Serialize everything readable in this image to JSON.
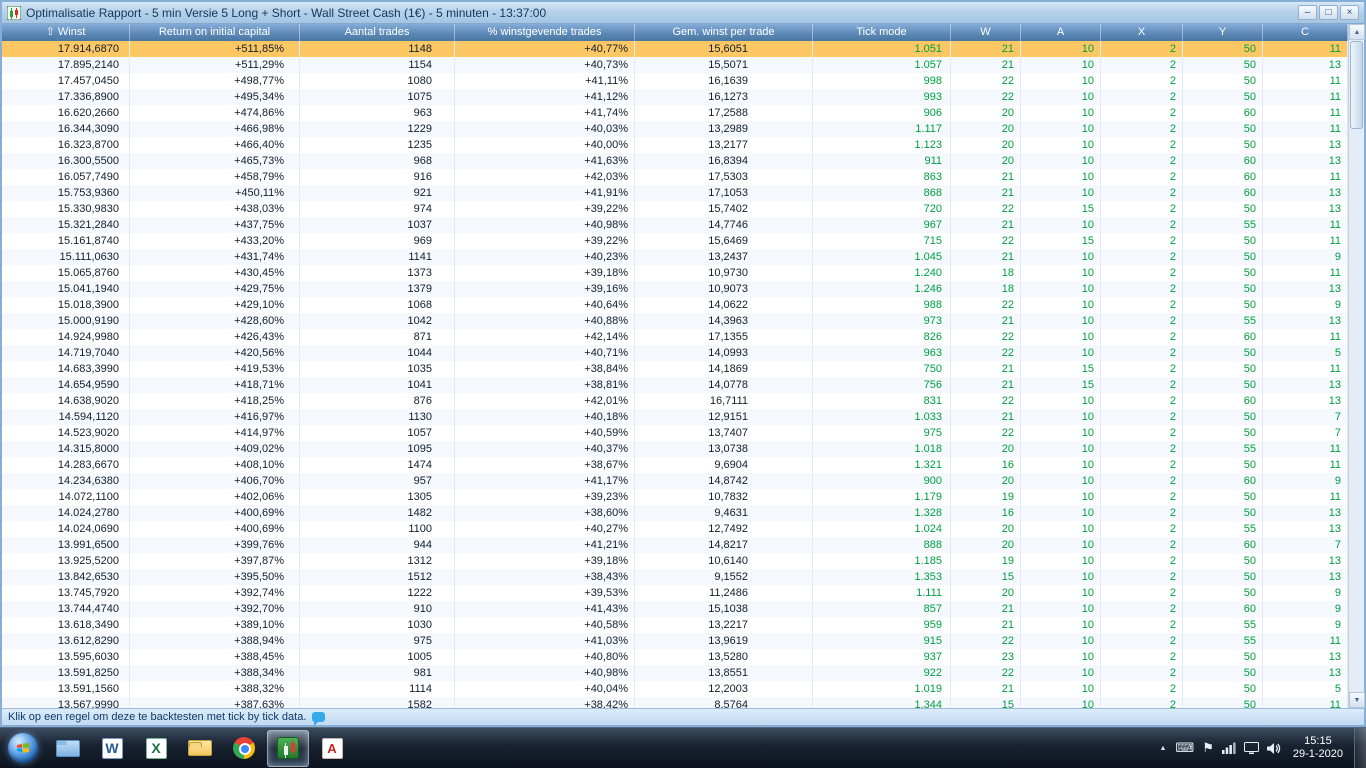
{
  "window": {
    "title": "Optimalisatie Rapport - 5 min Versie 5 Long + Short - Wall Street Cash (1€) - 5 minuten - 13:37:00",
    "buttons": {
      "minimize": "–",
      "maximize": "□",
      "close": "×"
    }
  },
  "table": {
    "sort_arrow": "⇧",
    "sort_column": "Winst",
    "selected_row_index": 0,
    "columns": [
      "Winst",
      "Return on initial capital",
      "Aantal trades",
      "% winstgevende trades",
      "Gem. winst per trade",
      "Tick mode",
      "W",
      "A",
      "X",
      "Y",
      "C"
    ],
    "rows": [
      [
        "17.914,6870",
        "+511,85%",
        "1148",
        "+40,77%",
        "15,6051",
        "1.051",
        "21",
        "10",
        "2",
        "50",
        "11"
      ],
      [
        "17.895,2140",
        "+511,29%",
        "1154",
        "+40,73%",
        "15,5071",
        "1.057",
        "21",
        "10",
        "2",
        "50",
        "13"
      ],
      [
        "17.457,0450",
        "+498,77%",
        "1080",
        "+41,11%",
        "16,1639",
        "998",
        "22",
        "10",
        "2",
        "50",
        "11"
      ],
      [
        "17.336,8900",
        "+495,34%",
        "1075",
        "+41,12%",
        "16,1273",
        "993",
        "22",
        "10",
        "2",
        "50",
        "11"
      ],
      [
        "16.620,2660",
        "+474,86%",
        "963",
        "+41,74%",
        "17,2588",
        "906",
        "20",
        "10",
        "2",
        "60",
        "11"
      ],
      [
        "16.344,3090",
        "+466,98%",
        "1229",
        "+40,03%",
        "13,2989",
        "1.117",
        "20",
        "10",
        "2",
        "50",
        "11"
      ],
      [
        "16.323,8700",
        "+466,40%",
        "1235",
        "+40,00%",
        "13,2177",
        "1.123",
        "20",
        "10",
        "2",
        "50",
        "13"
      ],
      [
        "16.300,5500",
        "+465,73%",
        "968",
        "+41,63%",
        "16,8394",
        "911",
        "20",
        "10",
        "2",
        "60",
        "13"
      ],
      [
        "16.057,7490",
        "+458,79%",
        "916",
        "+42,03%",
        "17,5303",
        "863",
        "21",
        "10",
        "2",
        "60",
        "11"
      ],
      [
        "15.753,9360",
        "+450,11%",
        "921",
        "+41,91%",
        "17,1053",
        "868",
        "21",
        "10",
        "2",
        "60",
        "13"
      ],
      [
        "15.330,9830",
        "+438,03%",
        "974",
        "+39,22%",
        "15,7402",
        "720",
        "22",
        "15",
        "2",
        "50",
        "13"
      ],
      [
        "15.321,2840",
        "+437,75%",
        "1037",
        "+40,98%",
        "14,7746",
        "967",
        "21",
        "10",
        "2",
        "55",
        "11"
      ],
      [
        "15.161,8740",
        "+433,20%",
        "969",
        "+39,22%",
        "15,6469",
        "715",
        "22",
        "15",
        "2",
        "50",
        "11"
      ],
      [
        "15.111,0630",
        "+431,74%",
        "1141",
        "+40,23%",
        "13,2437",
        "1.045",
        "21",
        "10",
        "2",
        "50",
        "9"
      ],
      [
        "15.065,8760",
        "+430,45%",
        "1373",
        "+39,18%",
        "10,9730",
        "1.240",
        "18",
        "10",
        "2",
        "50",
        "11"
      ],
      [
        "15.041,1940",
        "+429,75%",
        "1379",
        "+39,16%",
        "10,9073",
        "1.246",
        "18",
        "10",
        "2",
        "50",
        "13"
      ],
      [
        "15.018,3900",
        "+429,10%",
        "1068",
        "+40,64%",
        "14,0622",
        "988",
        "22",
        "10",
        "2",
        "50",
        "9"
      ],
      [
        "15.000,9190",
        "+428,60%",
        "1042",
        "+40,88%",
        "14,3963",
        "973",
        "21",
        "10",
        "2",
        "55",
        "13"
      ],
      [
        "14.924,9980",
        "+426,43%",
        "871",
        "+42,14%",
        "17,1355",
        "826",
        "22",
        "10",
        "2",
        "60",
        "11"
      ],
      [
        "14.719,7040",
        "+420,56%",
        "1044",
        "+40,71%",
        "14,0993",
        "963",
        "22",
        "10",
        "2",
        "50",
        "5"
      ],
      [
        "14.683,3990",
        "+419,53%",
        "1035",
        "+38,84%",
        "14,1869",
        "750",
        "21",
        "15",
        "2",
        "50",
        "11"
      ],
      [
        "14.654,9590",
        "+418,71%",
        "1041",
        "+38,81%",
        "14,0778",
        "756",
        "21",
        "15",
        "2",
        "50",
        "13"
      ],
      [
        "14.638,9020",
        "+418,25%",
        "876",
        "+42,01%",
        "16,7111",
        "831",
        "22",
        "10",
        "2",
        "60",
        "13"
      ],
      [
        "14.594,1120",
        "+416,97%",
        "1130",
        "+40,18%",
        "12,9151",
        "1.033",
        "21",
        "10",
        "2",
        "50",
        "7"
      ],
      [
        "14.523,9020",
        "+414,97%",
        "1057",
        "+40,59%",
        "13,7407",
        "975",
        "22",
        "10",
        "2",
        "50",
        "7"
      ],
      [
        "14.315,8000",
        "+409,02%",
        "1095",
        "+40,37%",
        "13,0738",
        "1.018",
        "20",
        "10",
        "2",
        "55",
        "11"
      ],
      [
        "14.283,6670",
        "+408,10%",
        "1474",
        "+38,67%",
        "9,6904",
        "1.321",
        "16",
        "10",
        "2",
        "50",
        "11"
      ],
      [
        "14.234,6380",
        "+406,70%",
        "957",
        "+41,17%",
        "14,8742",
        "900",
        "20",
        "10",
        "2",
        "60",
        "9"
      ],
      [
        "14.072,1100",
        "+402,06%",
        "1305",
        "+39,23%",
        "10,7832",
        "1.179",
        "19",
        "10",
        "2",
        "50",
        "11"
      ],
      [
        "14.024,2780",
        "+400,69%",
        "1482",
        "+38,60%",
        "9,4631",
        "1.328",
        "16",
        "10",
        "2",
        "50",
        "13"
      ],
      [
        "14.024,0690",
        "+400,69%",
        "1100",
        "+40,27%",
        "12,7492",
        "1.024",
        "20",
        "10",
        "2",
        "55",
        "13"
      ],
      [
        "13.991,6500",
        "+399,76%",
        "944",
        "+41,21%",
        "14,8217",
        "888",
        "20",
        "10",
        "2",
        "60",
        "7"
      ],
      [
        "13.925,5200",
        "+397,87%",
        "1312",
        "+39,18%",
        "10,6140",
        "1.185",
        "19",
        "10",
        "2",
        "50",
        "13"
      ],
      [
        "13.842,6530",
        "+395,50%",
        "1512",
        "+38,43%",
        "9,1552",
        "1.353",
        "15",
        "10",
        "2",
        "50",
        "13"
      ],
      [
        "13.745,7920",
        "+392,74%",
        "1222",
        "+39,53%",
        "11,2486",
        "1.111",
        "20",
        "10",
        "2",
        "50",
        "9"
      ],
      [
        "13.744,4740",
        "+392,70%",
        "910",
        "+41,43%",
        "15,1038",
        "857",
        "21",
        "10",
        "2",
        "60",
        "9"
      ],
      [
        "13.618,3490",
        "+389,10%",
        "1030",
        "+40,58%",
        "13,2217",
        "959",
        "21",
        "10",
        "2",
        "55",
        "9"
      ],
      [
        "13.612,8290",
        "+388,94%",
        "975",
        "+41,03%",
        "13,9619",
        "915",
        "22",
        "10",
        "2",
        "55",
        "11"
      ],
      [
        "13.595,6030",
        "+388,45%",
        "1005",
        "+40,80%",
        "13,5280",
        "937",
        "23",
        "10",
        "2",
        "50",
        "13"
      ],
      [
        "13.591,8250",
        "+388,34%",
        "981",
        "+40,98%",
        "13,8551",
        "922",
        "22",
        "10",
        "2",
        "50",
        "13"
      ],
      [
        "13.591,1560",
        "+388,32%",
        "1114",
        "+40,04%",
        "12,2003",
        "1.019",
        "21",
        "10",
        "2",
        "50",
        "5"
      ],
      [
        "13.567,9990",
        "+387,63%",
        "1582",
        "+38,42%",
        "8,5764",
        "1.344",
        "15",
        "10",
        "2",
        "50",
        "11"
      ]
    ]
  },
  "status_bar": {
    "text": "Klik op een regel om deze te backtesten met tick by tick data.",
    "icon": "speech-balloon"
  },
  "scrollbar": {
    "up_arrow": "▲",
    "down_arrow": "▼"
  },
  "taskbar": {
    "apps": [
      {
        "name": "explorer"
      },
      {
        "name": "word",
        "letter": "W"
      },
      {
        "name": "excel",
        "letter": "X"
      },
      {
        "name": "folder"
      },
      {
        "name": "chrome"
      },
      {
        "name": "trading-app",
        "active": true
      },
      {
        "name": "adobe-reader",
        "letter": "A"
      }
    ],
    "tray": {
      "hidden_icons_arrow": "▲",
      "keyboard_glyph": "⌨",
      "flag_glyph": "⚑",
      "clock_time": "15:15",
      "clock_date": "29-1-2020"
    }
  },
  "colors": {
    "selected_row_bg": "#fdc763",
    "green_value": "#00a040",
    "header_blue": "#5d89b9",
    "titlebar_blue": "#b6d1ea"
  }
}
